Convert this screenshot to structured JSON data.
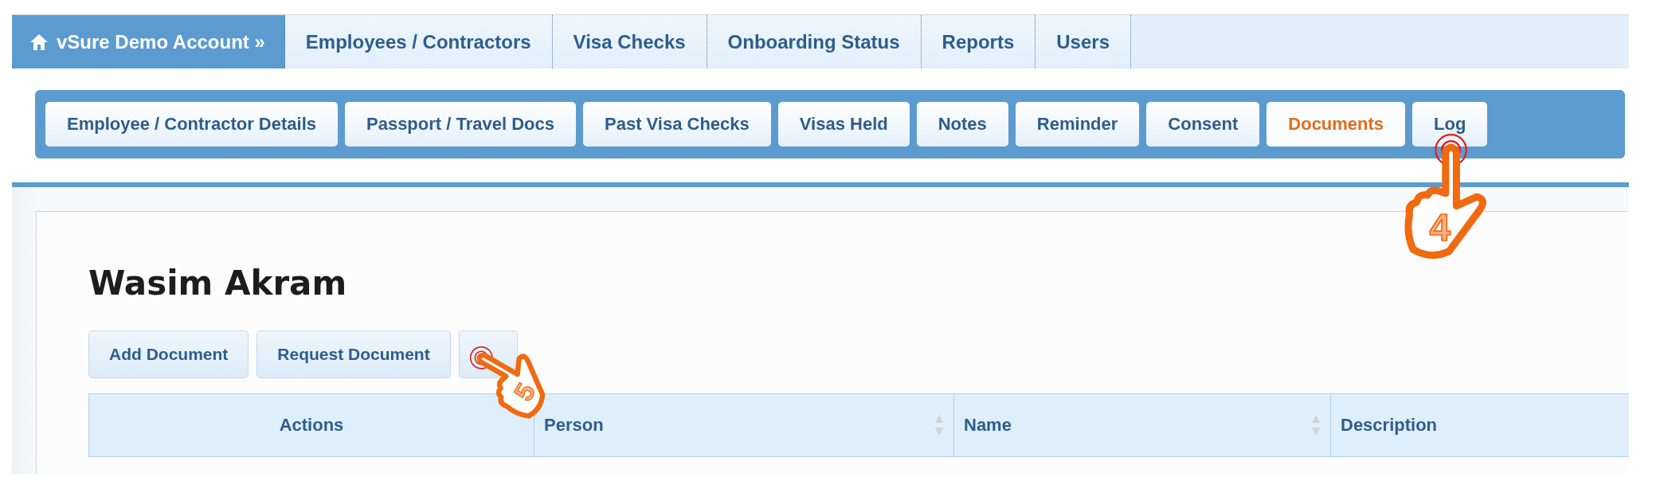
{
  "top_nav": [
    {
      "label": "vSure Demo Account »",
      "kind": "home"
    },
    {
      "label": "Employees / Contractors",
      "kind": "link"
    },
    {
      "label": "Visa Checks",
      "kind": "link"
    },
    {
      "label": "Onboarding Status",
      "kind": "link"
    },
    {
      "label": "Reports",
      "kind": "link"
    },
    {
      "label": "Users",
      "kind": "link"
    }
  ],
  "sub_tabs": [
    {
      "label": "Employee / Contractor Details",
      "selected": false
    },
    {
      "label": "Passport / Travel Docs",
      "selected": false
    },
    {
      "label": "Past Visa Checks",
      "selected": false
    },
    {
      "label": "Visas Held",
      "selected": false
    },
    {
      "label": "Notes",
      "selected": false
    },
    {
      "label": "Reminder",
      "selected": false
    },
    {
      "label": "Consent",
      "selected": false
    },
    {
      "label": "Documents",
      "selected": true
    },
    {
      "label": "Log",
      "selected": false
    }
  ],
  "heading": "Wasim Akram",
  "toolbar_buttons": [
    {
      "kind": "text",
      "label": "Add Document"
    },
    {
      "kind": "text",
      "label": "Request Document"
    },
    {
      "kind": "blank"
    }
  ],
  "table": {
    "columns": [
      {
        "label": "Actions",
        "sortable": false
      },
      {
        "label": "Person",
        "sortable": true
      },
      {
        "label": "Name",
        "sortable": true
      },
      {
        "label": "Description",
        "sortable": false
      }
    ]
  },
  "annotations": [
    {
      "label": "4",
      "kind": "tap"
    },
    {
      "label": "5",
      "kind": "tap"
    }
  ]
}
